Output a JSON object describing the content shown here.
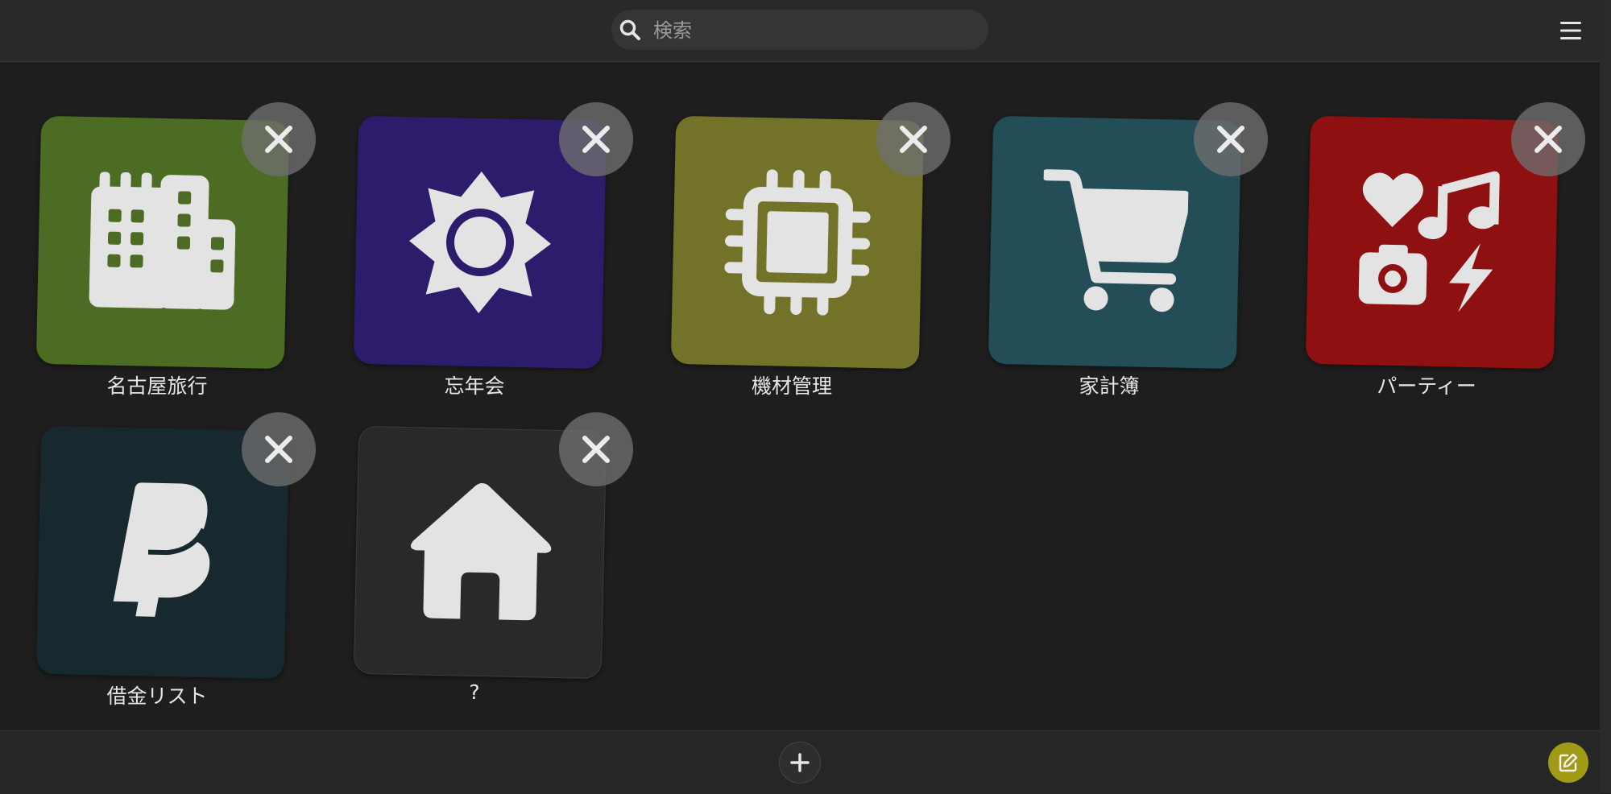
{
  "search": {
    "placeholder": "検索",
    "icon": "search-icon"
  },
  "header": {
    "menu_icon": "hamburger-menu-icon"
  },
  "tiles": [
    {
      "label": "名古屋旅行",
      "color": "#4c6b23",
      "icon": "city-buildings-icon"
    },
    {
      "label": "忘年会",
      "color": "#2d1b6b",
      "icon": "sun-icon"
    },
    {
      "label": "機材管理",
      "color": "#737229",
      "icon": "microchip-icon"
    },
    {
      "label": "家計簿",
      "color": "#234d57",
      "icon": "shopping-cart-icon"
    },
    {
      "label": "パーティー",
      "color": "#8e1010",
      "icon": "icons-heart-music-camera-bolt-icon"
    },
    {
      "label": "借金リスト",
      "color": "#18282f",
      "icon": "paypal-icon"
    },
    {
      "label": "?",
      "color": "#292929",
      "icon": "house-icon"
    }
  ],
  "footer": {
    "add_icon": "plus-icon",
    "edit_icon": "edit-pencil-icon",
    "edit_color": "#a19a16"
  }
}
